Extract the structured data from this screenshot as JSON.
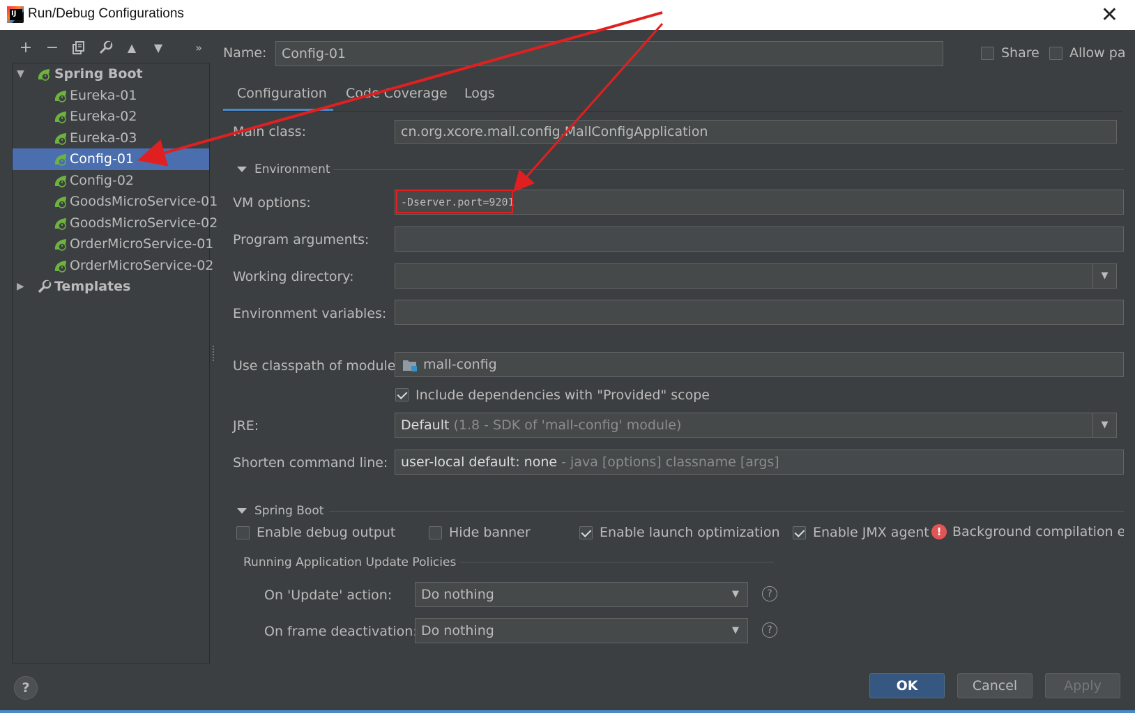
{
  "window": {
    "title": "Run/Debug Configurations",
    "close_glyph": "✕"
  },
  "toolbar": {
    "add": "+",
    "remove": "−",
    "copy": "⧉",
    "edit": "🔧",
    "up": "▲",
    "down": "▼",
    "more": "»"
  },
  "tree": {
    "spring_boot": "Spring Boot",
    "items": [
      "Eureka-01",
      "Eureka-02",
      "Eureka-03",
      "Config-01",
      "Config-02",
      "GoodsMicroService-01",
      "GoodsMicroService-02",
      "OrderMicroService-01",
      "OrderMicroService-02"
    ],
    "selected": "Config-01",
    "templates": "Templates"
  },
  "header": {
    "name_label": "Name:",
    "name_value": "Config-01",
    "share_label": "Share",
    "allow_label": "Allow pa"
  },
  "tabs": [
    "Configuration",
    "Code Coverage",
    "Logs"
  ],
  "active_tab": "Configuration",
  "config": {
    "main_class_label": "Main class:",
    "main_class_value": "cn.org.xcore.mall.config.MallConfigApplication",
    "environment_section": "Environment",
    "vm_options_label": "VM options:",
    "vm_options_value": "-Dserver.port=9201",
    "program_args_label": "Program arguments:",
    "program_args_value": "",
    "working_dir_label": "Working directory:",
    "working_dir_value": "",
    "env_vars_label": "Environment variables:",
    "env_vars_value": "",
    "classpath_label": "Use classpath of module:",
    "classpath_value": "mall-config",
    "include_deps_label": "Include dependencies with \"Provided\" scope",
    "jre_label": "JRE:",
    "jre_value": "Default",
    "jre_detail": "(1.8 - SDK of 'mall-config' module)",
    "shorten_label": "Shorten command line:",
    "shorten_value": "user-local default: none",
    "shorten_detail": "- java [options] classname [args]"
  },
  "spring_boot": {
    "section": "Spring Boot",
    "debug_output": "Enable debug output",
    "hide_banner": "Hide banner",
    "launch_opt": "Enable launch optimization",
    "jmx_agent": "Enable JMX agent",
    "bg_compilation": "Background compilation ena",
    "policies_section": "Running Application Update Policies",
    "update_action_label": "On 'Update' action:",
    "update_action_value": "Do nothing",
    "frame_deact_label": "On frame deactivation:",
    "frame_deact_value": "Do nothing"
  },
  "footer": {
    "ok": "OK",
    "cancel": "Cancel",
    "apply": "Apply",
    "help": "?"
  },
  "colors": {
    "background": "#3c3f41",
    "selection": "#4b6eaf",
    "accent": "#4a88c7",
    "annotation": "#e02020"
  }
}
